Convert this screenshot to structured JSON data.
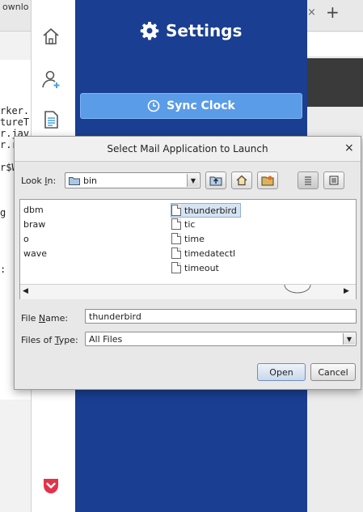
{
  "background": {
    "tab_text": "ownlo",
    "tab_close": "×",
    "tab_plus": "+",
    "code_lines": [
      "",
      "",
      "",
      "",
      "rker.",
      "tureT",
      "r.jav",
      "r.run",
      "",
      "r$Wor",
      "",
      "",
      "",
      "g",
      "",
      "",
      "",
      "",
      ":",
      "",
      ""
    ]
  },
  "settings": {
    "title": "Settings",
    "sync_button": "Sync Clock",
    "accent": "#1a3e91",
    "button_color": "#5b9ce8"
  },
  "nav": {
    "icons": [
      "home-icon",
      "add-user-icon",
      "document-icon",
      "pocket-icon"
    ]
  },
  "dialog": {
    "title": "Select Mail Application to Launch",
    "close": "×",
    "look_in_label_prefix": "Look ",
    "look_in_label_key": "I",
    "look_in_label_suffix": "n:",
    "look_in_value": "bin",
    "files_left": [
      "dbm",
      "braw",
      "o",
      "wave"
    ],
    "files_right": [
      "thunderbird",
      "tic",
      "time",
      "timedatectl",
      "timeout"
    ],
    "selected_file": "thunderbird",
    "file_name_label_prefix": "File ",
    "file_name_label_key": "N",
    "file_name_label_suffix": "ame:",
    "file_name_value": "thunderbird",
    "files_of_type_label_prefix": "Files of ",
    "files_of_type_label_key": "T",
    "files_of_type_label_suffix": "ype:",
    "files_of_type_value": "All Files",
    "open_button": "Open",
    "cancel_button": "Cancel"
  }
}
